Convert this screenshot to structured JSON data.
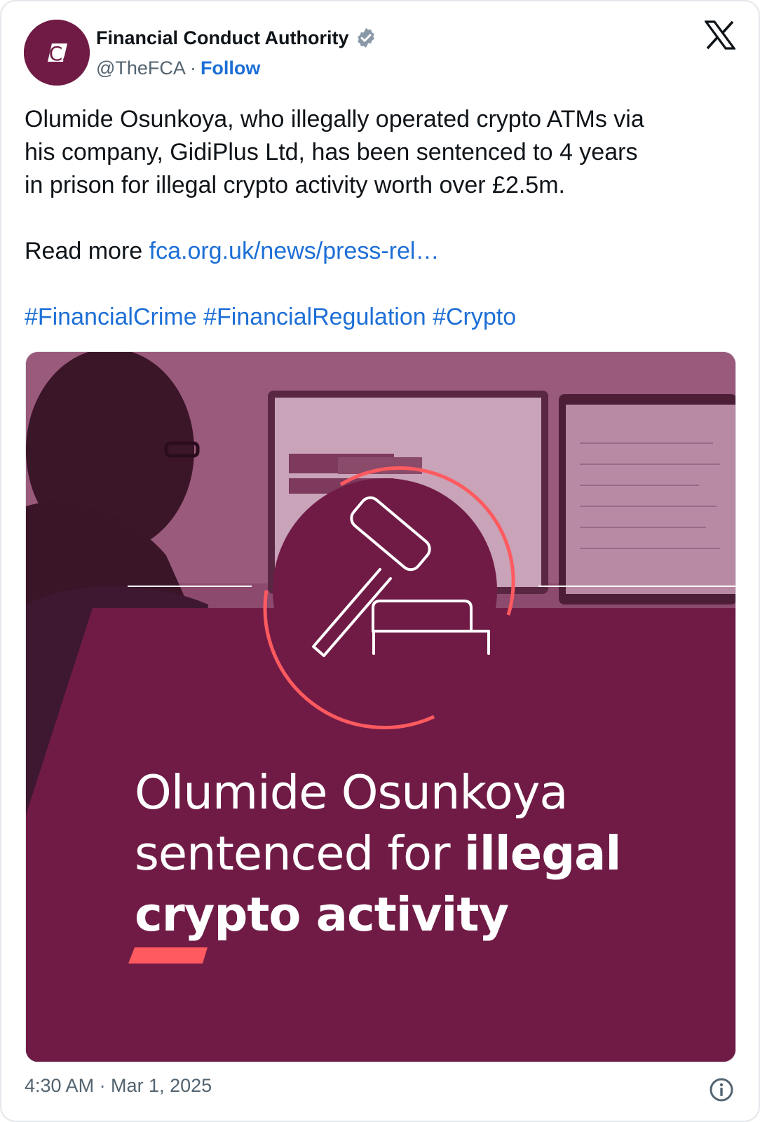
{
  "author": {
    "name": "Financial Conduct Authority",
    "handle": "@TheFCA",
    "separator": "·",
    "follow_label": "Follow",
    "avatar_text": "FCA",
    "verified_icon": "verified-badge-icon"
  },
  "platform_icon": "x-logo-icon",
  "tweet": {
    "line1": "Olumide Osunkoya, who illegally operated crypto ATMs via",
    "line2": "his company, GidiPlus Ltd, has been sentenced to 4 years",
    "line3": "in prison for illegal crypto activity worth over £2.5m.",
    "read_more_prefix": "Read more ",
    "link_text": "fca.org.uk/news/press-rel…",
    "hashtags": [
      "#FinancialCrime",
      "#FinancialRegulation",
      "#Crypto"
    ]
  },
  "media": {
    "headline_light_1": "Olumide Osunkoya",
    "headline_light_2": "sentenced for ",
    "headline_bold_1": "illegal",
    "headline_bold_2": "crypto activity",
    "icon": "gavel-icon",
    "colors": {
      "overlay": "#701b45",
      "accent": "#ff5a5f"
    }
  },
  "footer": {
    "timestamp": "4:30 AM · Mar 1, 2025",
    "info_icon": "info-icon"
  },
  "colors": {
    "link": "#1d6fd6",
    "muted": "#536471",
    "brand": "#701b45"
  }
}
